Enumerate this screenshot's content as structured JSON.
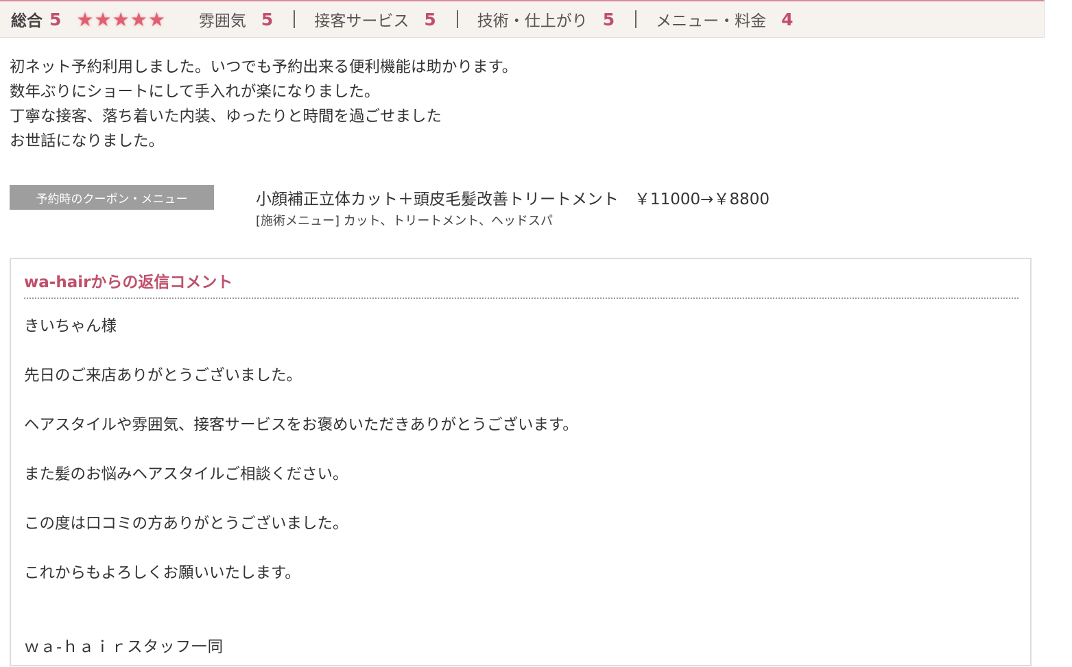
{
  "ratings": {
    "overall_label": "総合",
    "overall_score": "5",
    "stars": "★★★★★",
    "categories": [
      {
        "label": "雰囲気",
        "score": "5"
      },
      {
        "label": "接客サービス",
        "score": "5"
      },
      {
        "label": "技術・仕上がり",
        "score": "5"
      },
      {
        "label": "メニュー・料金",
        "score": "4"
      }
    ]
  },
  "review": {
    "lines": [
      "初ネット予約利用しました。いつでも予約出来る便利機能は助かります。",
      "数年ぶりにショートにして手入れが楽になりました。",
      "丁寧な接客、落ち着いた内装、ゆったりと時間を過ごせました",
      "お世話になりました。"
    ]
  },
  "coupon": {
    "tag": "予約時のクーポン・メニュー",
    "name": "小顔補正立体カット＋頭皮毛髪改善トリートメント　￥11000→￥8800",
    "menu": "[施術メニュー] カット、トリートメント、ヘッドスパ"
  },
  "reply": {
    "title": "wa-hairからの返信コメント",
    "lines": [
      "きいちゃん様",
      "先日のご来店ありがとうございました。",
      "ヘアスタイルや雰囲気、接客サービスをお褒めいただきありがとうございます。",
      "また髪のお悩みヘアスタイルご相談ください。",
      "この度は口コミの方ありがとうございました。",
      "これからもよろしくお願いいたします。"
    ],
    "signature": "ｗａ-ｈａｉｒスタッフ一同"
  },
  "colors": {
    "accent": "#c0506a",
    "star": "#e06070",
    "bar_bg": "#f6f2ee",
    "tag_bg": "#9e9e9e"
  }
}
